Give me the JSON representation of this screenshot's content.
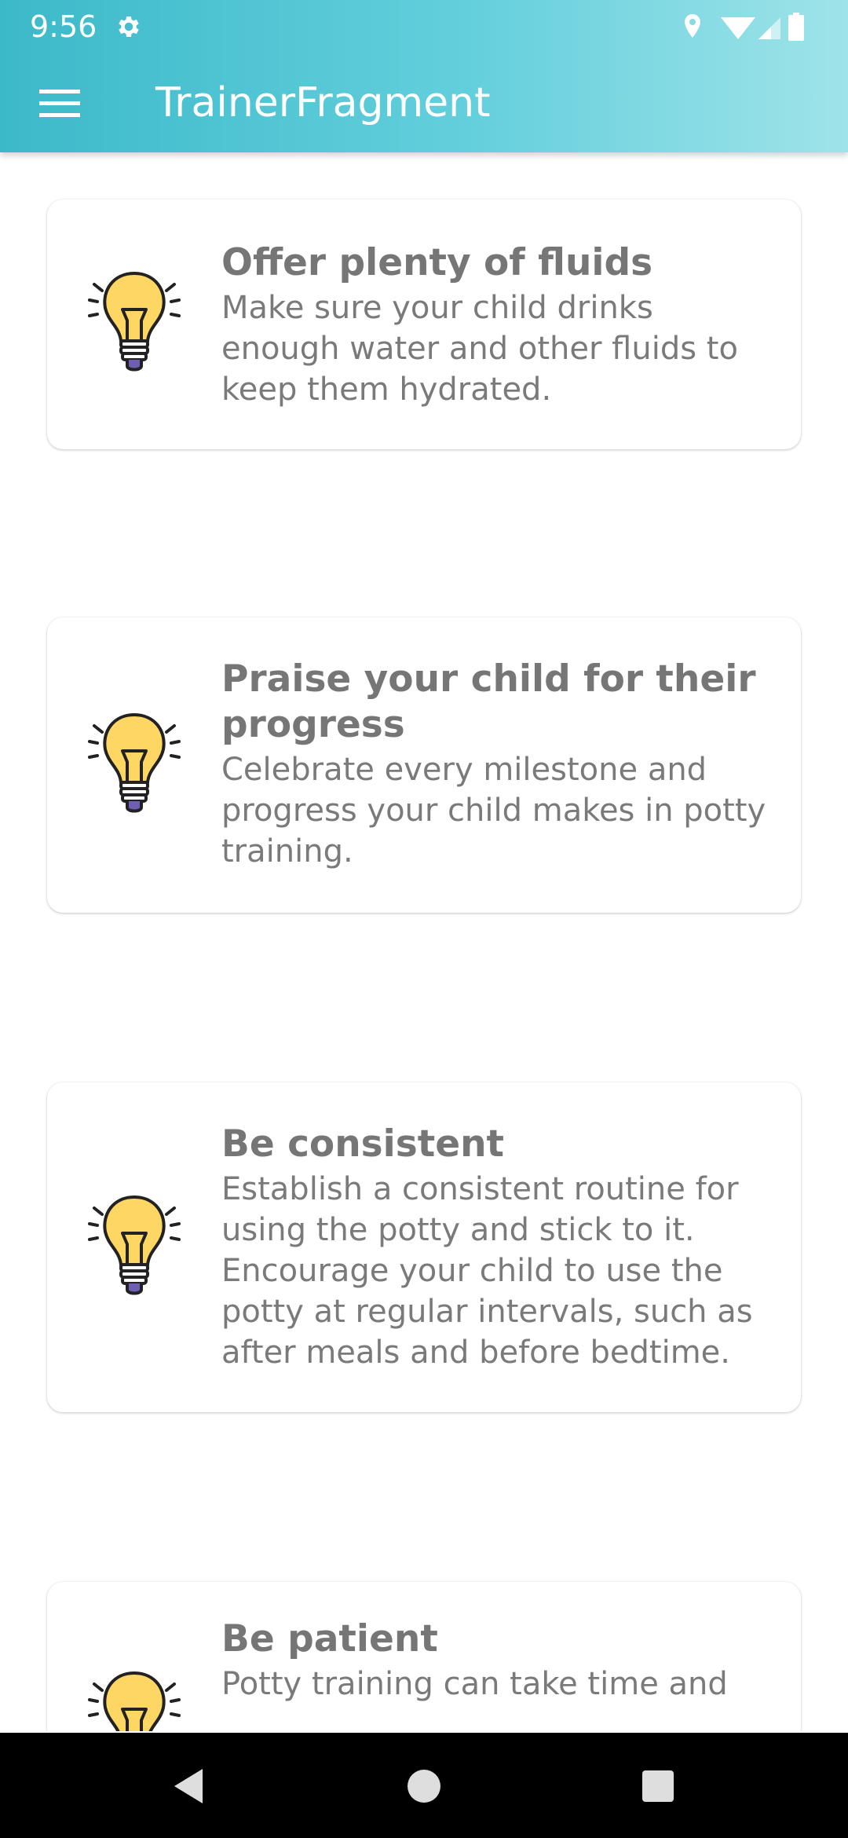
{
  "status_bar": {
    "time": "9:56",
    "icons": [
      "settings-gear-icon",
      "location-icon",
      "wifi-icon",
      "cellular-signal-icon",
      "battery-icon"
    ],
    "color": "#ffffff"
  },
  "toolbar": {
    "title": "TrainerFragment",
    "menu_icon": "hamburger-menu-icon",
    "gradient": [
      "#3cb9c9",
      "#9fe3e9"
    ]
  },
  "tips": [
    {
      "title": "Offer plenty of fluids",
      "body": "Make sure your child drinks enough water and other fluids to keep them hydrated.",
      "icon": "lightbulb-icon"
    },
    {
      "title": "Praise your child for their progress",
      "body": "Celebrate every milestone and progress your child makes in potty training.",
      "icon": "lightbulb-icon"
    },
    {
      "title": "Be consistent",
      "body": "Establish a consistent routine for using the potty and stick to it. Encourage your child to use the potty at regular intervals, such as after meals and before bedtime.",
      "icon": "lightbulb-icon"
    },
    {
      "title": "Be patient",
      "body": "Potty training can take time and",
      "icon": "lightbulb-icon"
    }
  ],
  "colors": {
    "title_text": "#767676",
    "body_text": "#7a7a7a",
    "bulb_fill": "#fdd663",
    "card_bg": "#ffffff"
  },
  "nav_bar": {
    "buttons": [
      "back-icon",
      "home-icon",
      "recents-icon"
    ]
  }
}
